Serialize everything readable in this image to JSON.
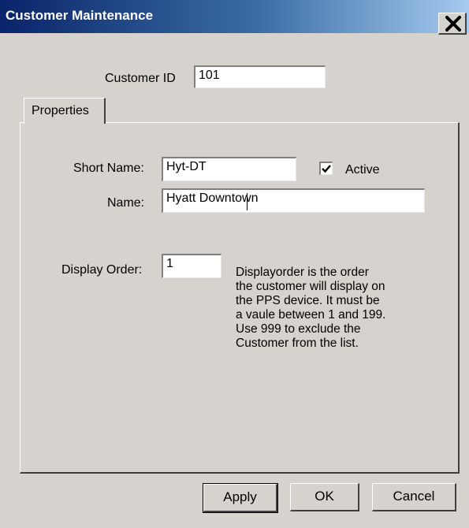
{
  "window": {
    "title": "Customer Maintenance"
  },
  "customer_id": {
    "label": "Customer ID",
    "value": "101"
  },
  "tabs": [
    {
      "label": "Properties"
    }
  ],
  "properties": {
    "short_name": {
      "label": "Short Name:",
      "value": "Hyt-DT"
    },
    "active": {
      "label": "Active",
      "checked": true
    },
    "name": {
      "label": "Name:",
      "value": "Hyatt Downtown"
    },
    "display_order": {
      "label": "Display Order:",
      "value": "1"
    },
    "help_lines": [
      "Displayorder is the order",
      "the customer will display on",
      "the PPS device. It must be",
      "a vaule between 1 and 199.",
      "Use 999 to exclude the",
      "Customer from the list."
    ]
  },
  "buttons": {
    "apply": "Apply",
    "ok": "OK",
    "cancel": "Cancel"
  },
  "icons": {
    "close": "close-icon",
    "check": "check-icon"
  },
  "colors": {
    "title_gradient_start": "#0a246a",
    "title_gradient_end": "#a6caf0",
    "face": "#d6d3ce"
  }
}
